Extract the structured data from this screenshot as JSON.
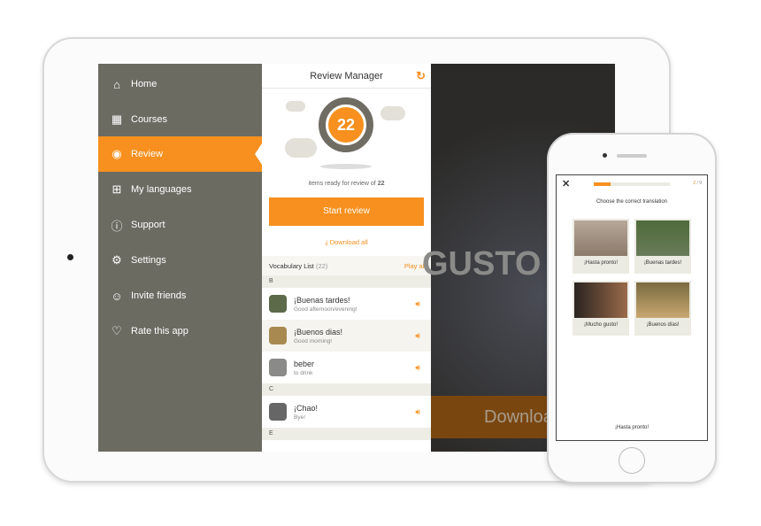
{
  "sidebar": {
    "items": [
      {
        "label": "Home",
        "icon": "home-icon"
      },
      {
        "label": "Courses",
        "icon": "grid-icon"
      },
      {
        "label": "Review",
        "icon": "review-icon",
        "active": true
      },
      {
        "label": "My languages",
        "icon": "languages-icon"
      },
      {
        "label": "Support",
        "icon": "help-icon"
      },
      {
        "label": "Settings",
        "icon": "gear-icon"
      },
      {
        "label": "Invite friends",
        "icon": "add-user-icon"
      },
      {
        "label": "Rate this app",
        "icon": "heart-icon"
      }
    ]
  },
  "review": {
    "title": "Review Manager",
    "count": "22",
    "ready_text": "items ready for review of",
    "ready_total": "22",
    "start_label": "Start review",
    "download_label": "Download all",
    "vocab_title": "Vocabulary List",
    "vocab_count": "(22)",
    "play_all": "Play all",
    "sections": [
      {
        "letter": "B",
        "items": [
          {
            "word": "¡Buenas tardes!",
            "translation": "Good afternoon/evening!"
          },
          {
            "word": "¡Buenos dias!",
            "translation": "Good morning!"
          },
          {
            "word": "beber",
            "translation": "to drink"
          }
        ]
      },
      {
        "letter": "C",
        "items": [
          {
            "word": "¡Chao!",
            "translation": "Bye!"
          }
        ]
      },
      {
        "letter": "E",
        "items": []
      }
    ]
  },
  "background": {
    "headline": "GUSTO",
    "download": "Downloa"
  },
  "phone": {
    "progress": "2",
    "total": "/ 9",
    "progress_fraction": 0.22,
    "prompt": "Choose the correct translation",
    "options": [
      "¡Hasta pronto!",
      "¡Buenas tardes!",
      "¡Mucho gusto!",
      "¡Buenos días!"
    ],
    "answer": "¡Hasta pronto!"
  },
  "colors": {
    "accent": "#f7901e",
    "sidebar": "#6c6b62"
  }
}
